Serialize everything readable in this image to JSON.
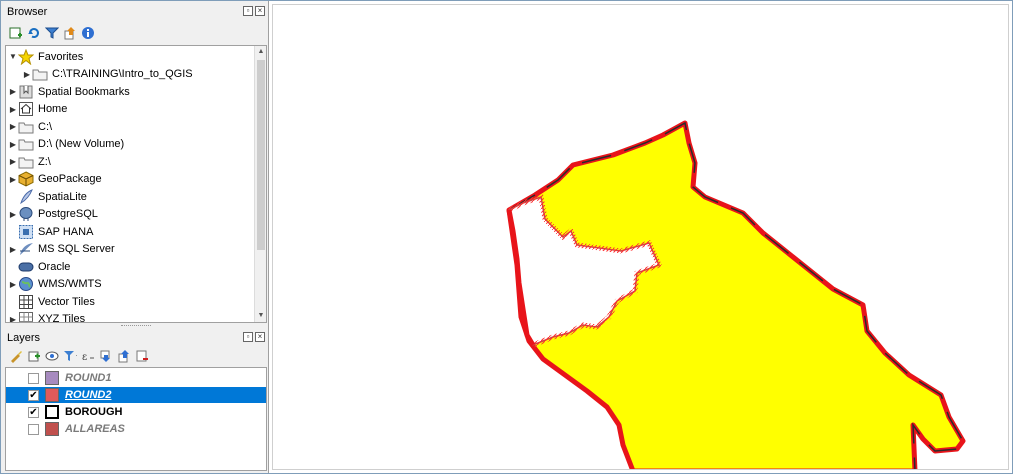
{
  "browser": {
    "title": "Browser",
    "toolbar_icons": [
      "add-layer-icon",
      "refresh-icon",
      "filter-icon",
      "collapse-all-icon",
      "info-icon"
    ],
    "items": [
      {
        "label": "Favorites",
        "icon": "star-icon",
        "expanded": true,
        "indent": 0
      },
      {
        "label": "C:\\TRAINING\\Intro_to_QGIS",
        "icon": "folder-icon",
        "expanded": false,
        "indent": 1
      },
      {
        "label": "Spatial Bookmarks",
        "icon": "bookmark-icon",
        "expanded": false,
        "indent": 0
      },
      {
        "label": "Home",
        "icon": "home-icon",
        "expanded": false,
        "indent": 0
      },
      {
        "label": "C:\\",
        "icon": "folder-icon",
        "expanded": false,
        "indent": 0
      },
      {
        "label": "D:\\ (New Volume)",
        "icon": "folder-icon",
        "expanded": false,
        "indent": 0
      },
      {
        "label": "Z:\\",
        "icon": "folder-icon",
        "expanded": false,
        "indent": 0
      },
      {
        "label": "GeoPackage",
        "icon": "geopackage-icon",
        "expanded": false,
        "indent": 0
      },
      {
        "label": "SpatiaLite",
        "icon": "spatialite-icon",
        "expanded": null,
        "indent": 0
      },
      {
        "label": "PostgreSQL",
        "icon": "postgresql-icon",
        "expanded": false,
        "indent": 0
      },
      {
        "label": "SAP HANA",
        "icon": "sap-hana-icon",
        "expanded": null,
        "indent": 0
      },
      {
        "label": "MS SQL Server",
        "icon": "mssql-icon",
        "expanded": false,
        "indent": 0
      },
      {
        "label": "Oracle",
        "icon": "oracle-icon",
        "expanded": null,
        "indent": 0
      },
      {
        "label": "WMS/WMTS",
        "icon": "wms-icon",
        "expanded": false,
        "indent": 0
      },
      {
        "label": "Vector Tiles",
        "icon": "vector-tiles-icon",
        "expanded": null,
        "indent": 0
      },
      {
        "label": "XYZ Tiles",
        "icon": "xyz-tiles-icon",
        "expanded": false,
        "indent": 0
      }
    ]
  },
  "layers": {
    "title": "Layers",
    "toolbar_icons": [
      "style-icon",
      "add-group-icon",
      "visibility-icon",
      "filter-legend-icon",
      "expression-filter-icon",
      "expand-all-icon",
      "collapse-all-icon",
      "remove-layer-icon"
    ],
    "items": [
      {
        "name": "ROUND1",
        "checked": false,
        "selected": false,
        "swatch": "#a78bbf",
        "swatch_type": "fill",
        "color": "#7a7a7a"
      },
      {
        "name": "ROUND2",
        "checked": true,
        "selected": true,
        "swatch": "#e05a5a",
        "swatch_type": "fill",
        "color": "#ffffff"
      },
      {
        "name": "BOROUGH",
        "checked": true,
        "selected": false,
        "swatch": "#000000",
        "swatch_type": "outline",
        "color": "#000000"
      },
      {
        "name": "ALLAREAS",
        "checked": false,
        "selected": false,
        "swatch": "#c0504d",
        "swatch_type": "fill",
        "color": "#7a7a7a"
      }
    ]
  },
  "map": {
    "fill_color": "#ffff00",
    "outline_color": "#e8141a",
    "border_color": "#2b2b2b"
  }
}
